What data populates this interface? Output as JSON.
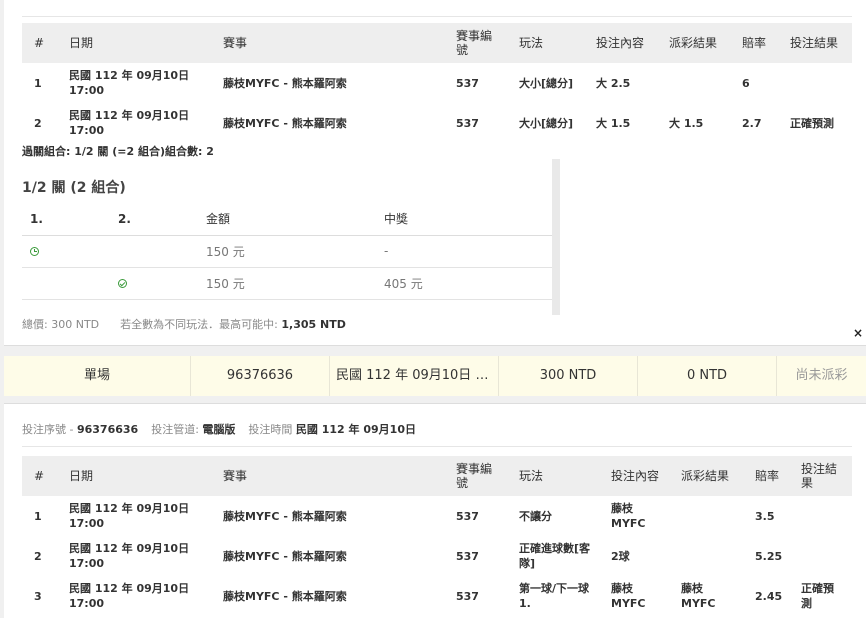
{
  "table1": {
    "headers": [
      "#",
      "日期",
      "賽事",
      "賽事編號",
      "玩法",
      "投注內容",
      "派彩結果",
      "賠率",
      "投注結果"
    ],
    "rows": [
      {
        "no": "1",
        "date": "民國 112 年 09月10日",
        "time": "17:00",
        "match": "藤枝MYFC - 熊本羅阿索",
        "code": "537",
        "play": "大小[總分]",
        "content": "大 2.5",
        "payout": "",
        "odds": "6",
        "result": ""
      },
      {
        "no": "2",
        "date": "民國 112 年 09月10日",
        "time": "17:00",
        "match": "藤枝MYFC - 熊本羅阿索",
        "code": "537",
        "play": "大小[總分]",
        "content": "大 1.5",
        "payout": "大 1.5",
        "odds": "2.7",
        "result": "正確預測"
      }
    ]
  },
  "combo_line": "過關組合: 1/2 關 (=2 組合)組合數: 2",
  "combo": {
    "title": "1/2 關 (2 組合)",
    "headers": [
      "1.",
      "2.",
      "金額",
      "中獎"
    ],
    "rows": [
      {
        "c1_icon": "clock-icon",
        "c2_icon": "",
        "amount": "150 元",
        "win": "-"
      },
      {
        "c1_icon": "",
        "c2_icon": "check-circle-icon",
        "amount": "150 元",
        "win": "405 元"
      }
    ]
  },
  "summary": {
    "total_label": "總價:",
    "total_value": "300 NTD",
    "max_label": "若全數為不同玩法．最高可能中:",
    "max_value": "1,305 NTD"
  },
  "close_label": "×",
  "ticket_row": {
    "type": "單場",
    "serial": "96376636",
    "date": "民國 112 年 09月10日 1…",
    "amount": "300 NTD",
    "win": "0 NTD",
    "status": "尚未派彩"
  },
  "meta": {
    "serial_label": "投注序號 -",
    "serial_value": "96376636",
    "channel_label": "投注管道:",
    "channel_value": "電腦版",
    "time_label": "投注時間",
    "time_value": "民國 112 年 09月10日"
  },
  "table2": {
    "headers": [
      "#",
      "日期",
      "賽事",
      "賽事編號",
      "玩法",
      "投注內容",
      "派彩結果",
      "賠率",
      "投注結果"
    ],
    "rows": [
      {
        "no": "1",
        "date": "民國 112 年 09月10日",
        "time": "17:00",
        "match": "藤枝MYFC - 熊本羅阿索",
        "code": "537",
        "play": "不讓分",
        "content": "藤枝 MYFC",
        "payout": "",
        "odds": "3.5",
        "result": ""
      },
      {
        "no": "2",
        "date": "民國 112 年 09月10日",
        "time": "17:00",
        "match": "藤枝MYFC - 熊本羅阿索",
        "code": "537",
        "play": "正確進球數[客隊]",
        "content": "2球",
        "payout": "",
        "odds": "5.25",
        "result": ""
      },
      {
        "no": "3",
        "date": "民國 112 年 09月10日",
        "time": "17:00",
        "match": "藤枝MYFC - 熊本羅阿索",
        "code": "537",
        "play": "第一球/下一球 1.",
        "content": "藤枝 MYFC",
        "payout": "藤枝 MYFC",
        "odds": "2.45",
        "result": "正確預測"
      }
    ]
  }
}
